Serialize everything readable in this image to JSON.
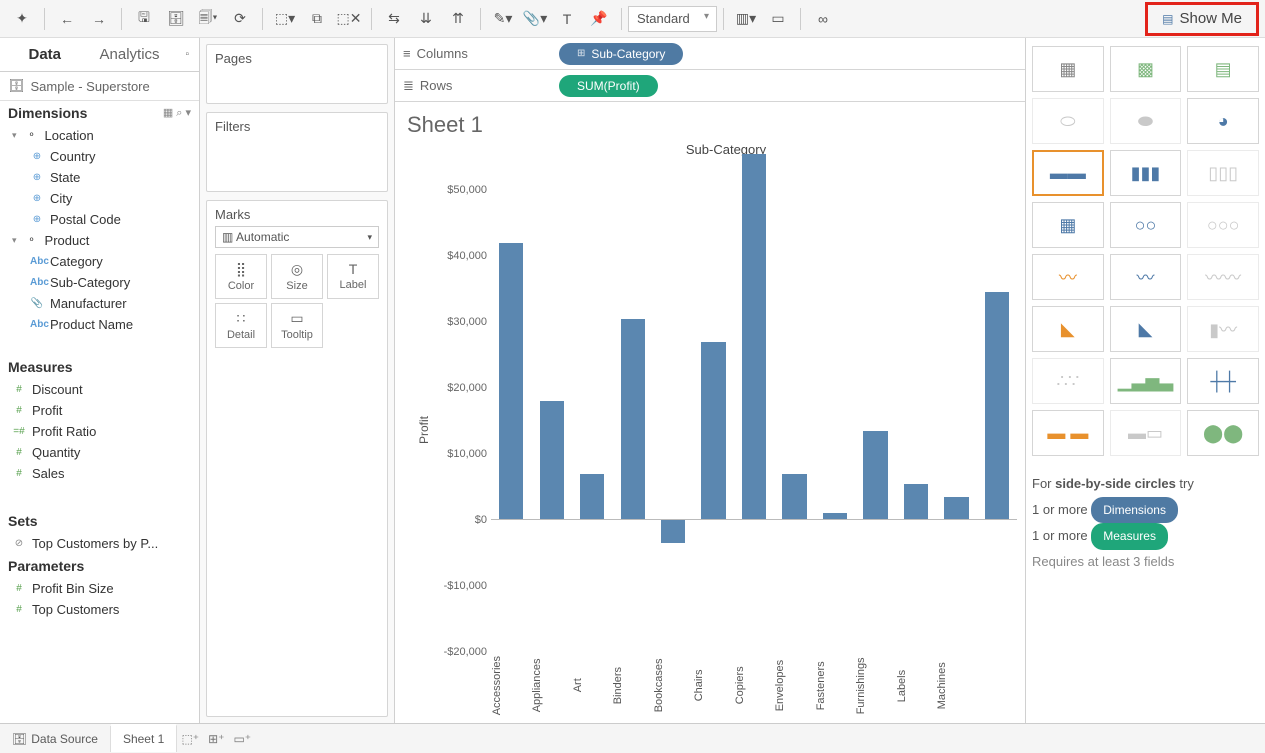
{
  "toolbar": {
    "view_mode": "Standard",
    "show_me": "Show Me"
  },
  "data_pane": {
    "tab_data": "Data",
    "tab_analytics": "Analytics",
    "datasource": "Sample - Superstore",
    "dimensions_hdr": "Dimensions",
    "measures_hdr": "Measures",
    "sets_hdr": "Sets",
    "parameters_hdr": "Parameters",
    "dimensions": {
      "group_location": "Location",
      "country": "Country",
      "state": "State",
      "city": "City",
      "postal": "Postal Code",
      "group_product": "Product",
      "category": "Category",
      "subcategory": "Sub-Category",
      "manufacturer": "Manufacturer",
      "product_name": "Product Name"
    },
    "measures": {
      "discount": "Discount",
      "profit": "Profit",
      "profit_ratio": "Profit Ratio",
      "quantity": "Quantity",
      "sales": "Sales"
    },
    "sets": {
      "top_customers": "Top Customers by P..."
    },
    "parameters": {
      "profit_bin": "Profit Bin Size",
      "top_customers": "Top Customers"
    }
  },
  "cards": {
    "pages": "Pages",
    "filters": "Filters",
    "marks": "Marks",
    "marks_type": "Automatic",
    "color": "Color",
    "size": "Size",
    "label": "Label",
    "detail": "Detail",
    "tooltip": "Tooltip"
  },
  "shelves": {
    "columns": "Columns",
    "rows": "Rows",
    "columns_pill": "Sub-Category",
    "rows_pill": "SUM(Profit)"
  },
  "sheet": {
    "title": "Sheet 1",
    "axis_title": "Sub-Category",
    "y_title": "Profit"
  },
  "chart_data": {
    "type": "bar",
    "title": "Sub-Category",
    "ylabel": "Profit",
    "ylim": [
      -20000,
      55000
    ],
    "categories": [
      "Accessories",
      "Appliances",
      "Art",
      "Binders",
      "Bookcases",
      "Chairs",
      "Copiers",
      "Envelopes",
      "Fasteners",
      "Furnishings",
      "Labels",
      "Machines"
    ],
    "values": [
      42000,
      18000,
      7000,
      30500,
      -3500,
      27000,
      55500,
      7000,
      1000,
      13500,
      5500,
      3500
    ],
    "extra_values_cut": [
      34500
    ],
    "y_ticks": [
      "$50,000",
      "$40,000",
      "$30,000",
      "$20,000",
      "$10,000",
      "$0",
      "-$10,000",
      "-$20,000"
    ]
  },
  "show_me_panel": {
    "hint_prefix": "For ",
    "hint_viz": "side-by-side circles",
    "hint_suffix": " try",
    "line1_prefix": "1 or more ",
    "dim_chip": "Dimensions",
    "line2_prefix": "1 or more ",
    "meas_chip": "Measures",
    "requires": "Requires at least 3 fields"
  },
  "footer": {
    "data_source": "Data Source",
    "sheet1": "Sheet 1"
  }
}
